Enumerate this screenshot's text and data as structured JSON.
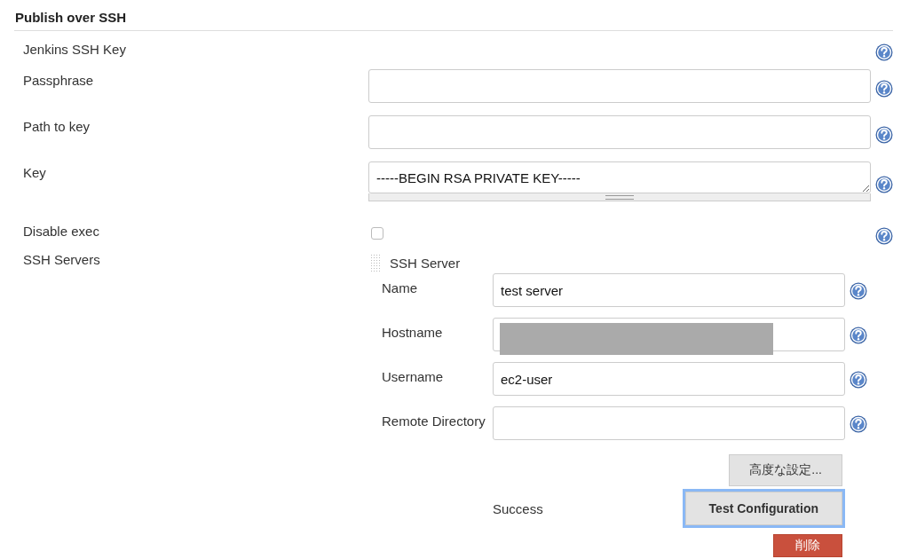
{
  "section": {
    "title": "Publish over SSH"
  },
  "fields": [
    {
      "kind": "none",
      "label": "Jenkins SSH Key"
    },
    {
      "kind": "text",
      "label": "Passphrase"
    },
    {
      "kind": "text",
      "label": "Path to key"
    },
    {
      "kind": "textarea",
      "label": "Key",
      "value": "-----BEGIN RSA PRIVATE KEY-----"
    },
    {
      "kind": "checkbox",
      "label": "Disable exec",
      "checked": false
    }
  ],
  "ssh_servers": {
    "label": "SSH Servers",
    "title": "SSH Server",
    "fields": [
      {
        "label": "Name",
        "value": "test server",
        "redacted": false
      },
      {
        "label": "Hostname",
        "redacted": true
      },
      {
        "label": "Username",
        "value": "ec2-user",
        "redacted": false
      },
      {
        "label": "Remote Directory",
        "redacted": false
      }
    ],
    "advanced_button": "高度な設定...",
    "test_status": "Success",
    "test_button": {
      "label": "Test Configuration",
      "focused": true
    },
    "delete_button": "削除"
  }
}
